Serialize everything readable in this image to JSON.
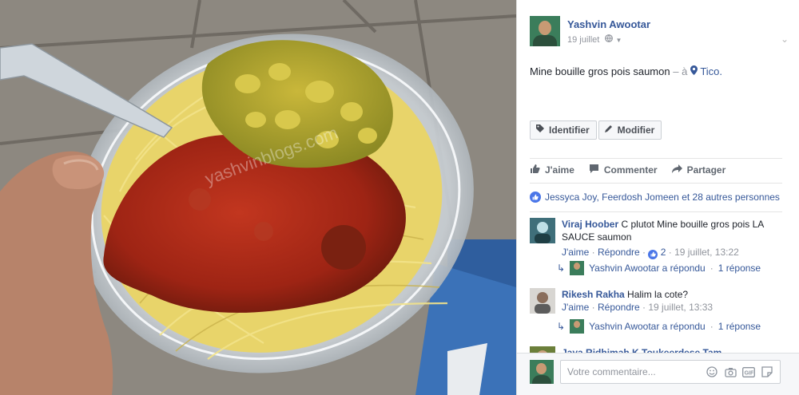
{
  "photo": {
    "watermark": "yashvinblogs.com"
  },
  "post": {
    "author": "Yashvin Awootar",
    "date": "19 juillet",
    "text": "Mine bouille gros pois saumon",
    "at_sep": "– à",
    "place": "Tico.",
    "buttons": {
      "tag": "Identifier",
      "edit": "Modifier"
    }
  },
  "actions": {
    "like": "J'aime",
    "comment": "Commenter",
    "share": "Partager"
  },
  "likes": {
    "text": "Jessyca Joy, Feerdosh Jomeen et 28 autres personnes"
  },
  "comments": [
    {
      "name": "Viraj Hoober",
      "text": "C plutot Mine bouille gros pois LA SAUCE saumon",
      "like": "J'aime",
      "reply": "Répondre",
      "reactions": "2",
      "time": "19 juillet, 13:22",
      "reply_summary": {
        "name": "Yashvin Awootar a répondu",
        "count": "1 réponse"
      }
    },
    {
      "name": "Rikesh Rakha",
      "text": "Halim la cote?",
      "like": "J'aime",
      "reply": "Répondre",
      "time": "19 juillet, 13:33",
      "reply_summary": {
        "name": "Yashvin Awootar a répondu",
        "count": "1 réponse"
      }
    },
    {
      "name": "Jaya Ridhimah K Toukeerdese Tam"
    }
  ],
  "composer": {
    "placeholder": "Votre commentaire..."
  },
  "icons": [
    "globe-icon",
    "tag-icon",
    "pencil-icon",
    "thumbs-up-icon",
    "comment-icon",
    "share-icon",
    "emoji-icon",
    "camera-icon",
    "gif-icon",
    "sticker-icon"
  ],
  "colors": {
    "link": "#365899",
    "like_blue": "#4a76e8",
    "meta_gray": "#90949c"
  }
}
